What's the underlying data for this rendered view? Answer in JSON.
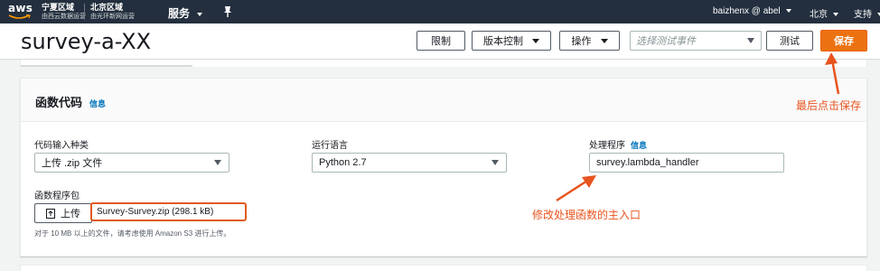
{
  "topnav": {
    "logo_text": "aws",
    "region1": {
      "name": "宁夏区域",
      "sub": "由西云数据运营"
    },
    "region2": {
      "name": "北京区域",
      "sub": "由光环新网运营"
    },
    "services_label": "服务",
    "user_label": "baizhenx @ abel",
    "region_label": "北京",
    "support_label": "支持"
  },
  "header": {
    "title": "survey-a-XX",
    "throttle_label": "限制",
    "version_label": "版本控制",
    "actions_label": "操作",
    "test_event_placeholder": "选择测试事件",
    "test_label": "测试",
    "save_label": "保存"
  },
  "function_code": {
    "title": "函数代码",
    "info_label": "信息",
    "code_entry": {
      "label": "代码输入种类",
      "value": "上传 .zip 文件"
    },
    "runtime": {
      "label": "运行语言",
      "value": "Python 2.7"
    },
    "handler": {
      "label": "处理程序",
      "info_label": "信息",
      "value": "survey.lambda_handler"
    },
    "package": {
      "label": "函数程序包",
      "upload_label": "上传",
      "file_name": "Survey-Survey.zip (298.1 kB)",
      "hint": "对于 10 MB 以上的文件，请考虑使用 Amazon S3 进行上传。"
    }
  },
  "annotations": {
    "save_note": "最后点击保存",
    "handler_note": "修改处理函数的主入口"
  },
  "colors": {
    "nav_bg": "#232f3e",
    "save_orange": "#ec7211",
    "annotation": "#e8541f",
    "link_blue": "#0073bb"
  }
}
